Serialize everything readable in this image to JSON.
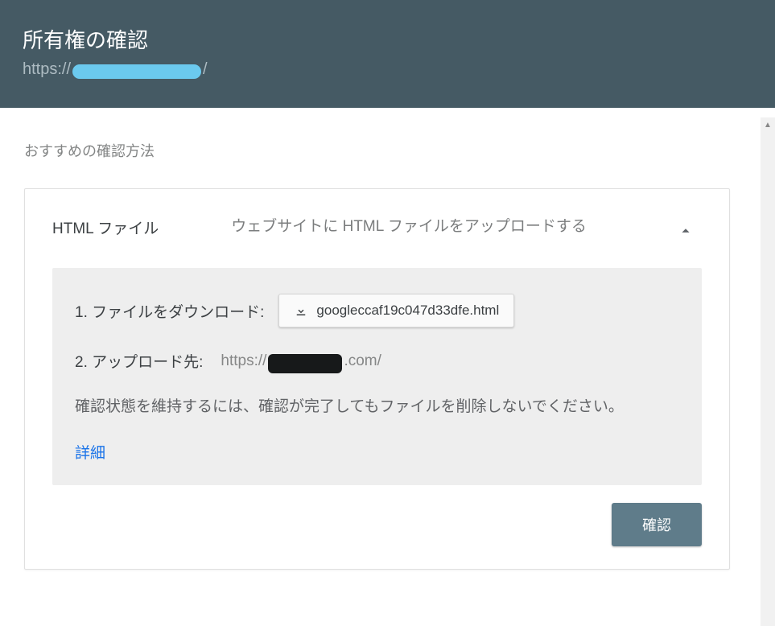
{
  "header": {
    "title": "所有権の確認",
    "url_prefix": "https://",
    "url_suffix": "/"
  },
  "section": {
    "recommended_label": "おすすめの確認方法"
  },
  "card": {
    "method_name": "HTML ファイル",
    "method_desc": "ウェブサイトに HTML ファイルをアップロードする",
    "step1_label": "1. ファイルをダウンロード:",
    "download_filename": "googleccaf19c047d33dfe.html",
    "step2_label": "2. アップロード先:",
    "upload_url_prefix": "https://",
    "upload_url_suffix": ".com/",
    "note": "確認状態を維持するには、確認が完了してもファイルを削除しないでください。",
    "details_link": "詳細",
    "verify_button": "確認"
  }
}
